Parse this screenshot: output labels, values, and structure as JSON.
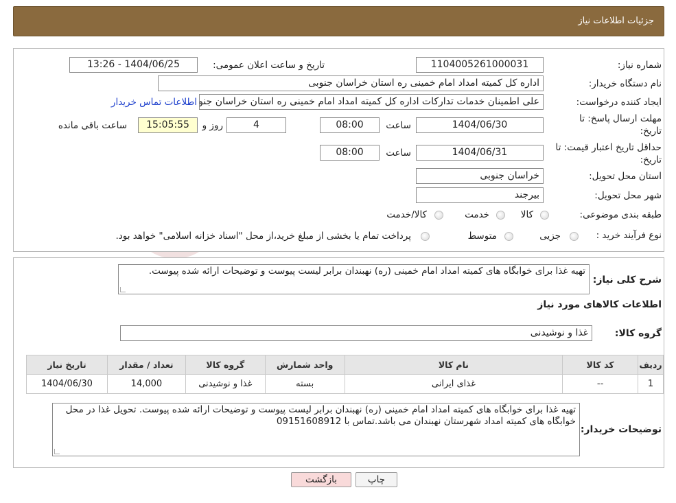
{
  "header": {
    "title": "جزئیات اطلاعات نیاز"
  },
  "form": {
    "need_number_label": "شماره نیاز:",
    "need_number": "1104005261000031",
    "announce_label": "تاریخ و ساعت اعلان عمومی:",
    "announce_value": "1404/06/25 - 13:26",
    "buyer_org_label": "نام دستگاه خریدار:",
    "buyer_org": "اداره کل کمیته امداد امام خمینی  ره  استان خراسان جنوبی",
    "creator_label": "ایجاد کننده درخواست:",
    "creator": "علی اطمینان خدمات تدارکات اداره کل کمیته امداد امام خمینی  ره  استان خراسان جنوبی",
    "contact_link": "اطلاعات تماس خریدار",
    "deadline_label_1": "مهلت ارسال پاسخ: تا",
    "deadline_label_2": "تاریخ:",
    "deadline_date": "1404/06/30",
    "time_label": "ساعت",
    "deadline_time": "08:00",
    "days": "4",
    "days_label": "روز و",
    "remaining": "15:05:55",
    "remaining_label": "ساعت باقی مانده",
    "validity_label_1": "حداقل تاریخ اعتبار قیمت: تا",
    "validity_label_2": "تاریخ:",
    "validity_date": "1404/06/31",
    "validity_time": "08:00",
    "province_label": "استان محل تحویل:",
    "province": "خراسان جنوبی",
    "city_label": "شهر محل تحویل:",
    "city": "بیرجند",
    "category_label": "طبقه بندی موضوعی:",
    "category_options": [
      "کالا",
      "خدمت",
      "کالا/خدمت"
    ],
    "process_label": "نوع فرآیند خرید :",
    "process_options": [
      "جزیی",
      "متوسط"
    ],
    "process_note": "پرداخت تمام یا بخشی از مبلغ خرید،از محل \"اسناد خزانه اسلامی\" خواهد بود."
  },
  "details": {
    "summary_label": "شرح کلی نیاز:",
    "summary": "تهیه غذا برای خوابگاه های کمیته امداد امام خمینی (ره) نهبندان برابر لیست پیوست و توضیحات ارائه شده پیوست.",
    "goods_title": "اطلاعات کالاهای مورد نیاز",
    "goods_group_label": "گروه کالا:",
    "goods_group": "غذا و نوشیدنی",
    "table": {
      "headers": [
        "ردیف",
        "کد کالا",
        "نام کالا",
        "واحد شمارش",
        "گروه کالا",
        "تعداد / مقدار",
        "تاریخ نیاز"
      ],
      "rows": [
        [
          "1",
          "--",
          "غذای ایرانی",
          "بسته",
          "غذا و نوشیدنی",
          "14,000",
          "1404/06/30"
        ]
      ]
    },
    "buyer_notes_label": "توضیحات خریدار:",
    "buyer_notes": "تهیه غذا برای خوابگاه های کمیته امداد امام خمینی (ره) نهبندان برابر لیست پیوست و توضیحات ارائه شده پیوست. تحویل غذا در محل خوابگاه های کمیته امداد شهرستان نهبندان می باشد.تماس با 09151608912"
  },
  "buttons": {
    "print": "چاپ",
    "back": "بازگشت"
  },
  "watermark": {
    "text": "AriaTender.neT"
  },
  "colors": {
    "header_bg": "#8a6a3e",
    "link": "#1a3dcc",
    "back_button_bg": "#f9dada",
    "remaining_bg": "#ffffd0"
  }
}
